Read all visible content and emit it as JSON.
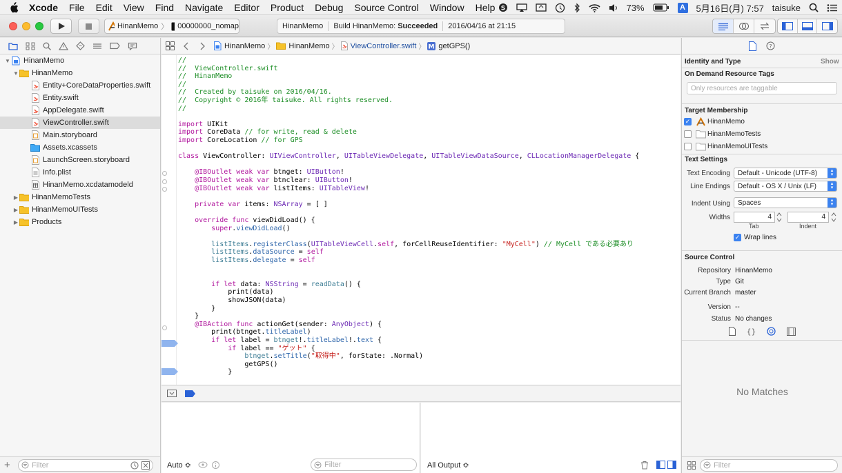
{
  "menubar": {
    "app_name": "Xcode",
    "items": [
      "File",
      "Edit",
      "View",
      "Find",
      "Navigate",
      "Editor",
      "Product",
      "Debug",
      "Source Control",
      "Window",
      "Help"
    ],
    "battery": "73%",
    "ime": "A",
    "clock": "5月16日(月)  7:57",
    "user": "taisuke"
  },
  "toolbar": {
    "scheme_target": "HinanMemo",
    "scheme_device": "00000000_nomap",
    "activity_project": "HinanMemo",
    "activity_action": "Build HinanMemo:",
    "activity_status": "Succeeded",
    "activity_time": "2016/04/16 at 21:15"
  },
  "navigator": {
    "items": [
      {
        "label": "HinanMemo",
        "icon": "project-icon",
        "disclosure": "▼"
      },
      {
        "label": "HinanMemo",
        "icon": "folder-icon",
        "disclosure": "▼"
      },
      {
        "label": "Entity+CoreDataProperties.swift",
        "icon": "swift-file-icon",
        "disclosure": ""
      },
      {
        "label": "Entity.swift",
        "icon": "swift-file-icon",
        "disclosure": ""
      },
      {
        "label": "AppDelegate.swift",
        "icon": "swift-file-icon",
        "disclosure": ""
      },
      {
        "label": "ViewController.swift",
        "icon": "swift-file-icon",
        "disclosure": "",
        "selected": true
      },
      {
        "label": "Main.storyboard",
        "icon": "storyboard-icon",
        "disclosure": ""
      },
      {
        "label": "Assets.xcassets",
        "icon": "assets-icon",
        "disclosure": ""
      },
      {
        "label": "LaunchScreen.storyboard",
        "icon": "storyboard-icon",
        "disclosure": ""
      },
      {
        "label": "Info.plist",
        "icon": "plist-icon",
        "disclosure": ""
      },
      {
        "label": "HinanMemo.xcdatamodeld",
        "icon": "datamodel-icon",
        "disclosure": ""
      },
      {
        "label": "HinanMemoTests",
        "icon": "folder-icon",
        "disclosure": "▶"
      },
      {
        "label": "HinanMemoUITests",
        "icon": "folder-icon",
        "disclosure": "▶"
      },
      {
        "label": "Products",
        "icon": "folder-icon",
        "disclosure": "▶"
      }
    ],
    "filter_placeholder": "Filter"
  },
  "jumpbar": {
    "crumbs": [
      "HinanMemo",
      "HinanMemo",
      "ViewController.swift",
      "getGPS()"
    ]
  },
  "code_lines": [
    [
      [
        "cmt",
        "//"
      ]
    ],
    [
      [
        "cmt",
        "//  ViewController.swift"
      ]
    ],
    [
      [
        "cmt",
        "//  HinanMemo"
      ]
    ],
    [
      [
        "cmt",
        "//"
      ]
    ],
    [
      [
        "cmt",
        "//  Created by taisuke on 2016/04/16."
      ]
    ],
    [
      [
        "cmt",
        "//  Copyright © 2016年 taisuke. All rights reserved."
      ]
    ],
    [
      [
        "cmt",
        "//"
      ]
    ],
    [],
    [
      [
        "kw",
        "import"
      ],
      [
        "pl",
        " UIKit"
      ]
    ],
    [
      [
        "kw",
        "import"
      ],
      [
        "pl",
        " CoreData "
      ],
      [
        "cmt",
        "// for write, read & delete"
      ]
    ],
    [
      [
        "kw",
        "import"
      ],
      [
        "pl",
        " CoreLocation "
      ],
      [
        "cmt",
        "// for GPS"
      ]
    ],
    [],
    [
      [
        "kw",
        "class"
      ],
      [
        "pl",
        " ViewController: "
      ],
      [
        "ty",
        "UIViewController"
      ],
      [
        "pl",
        ", "
      ],
      [
        "ty",
        "UITableViewDelegate"
      ],
      [
        "pl",
        ", "
      ],
      [
        "ty",
        "UITableViewDataSource"
      ],
      [
        "pl",
        ", "
      ],
      [
        "ty",
        "CLLocationManagerDelegate"
      ],
      [
        "pl",
        " {"
      ]
    ],
    [],
    [
      [
        "pl",
        "    "
      ],
      [
        "kw",
        "@IBOutlet weak var"
      ],
      [
        "pl",
        " btnget: "
      ],
      [
        "ty",
        "UIButton"
      ],
      [
        "pl",
        "!"
      ]
    ],
    [
      [
        "pl",
        "    "
      ],
      [
        "kw",
        "@IBOutlet weak var"
      ],
      [
        "pl",
        " btnclear: "
      ],
      [
        "ty",
        "UIButton"
      ],
      [
        "pl",
        "!"
      ]
    ],
    [
      [
        "pl",
        "    "
      ],
      [
        "kw",
        "@IBOutlet weak var"
      ],
      [
        "pl",
        " listItems: "
      ],
      [
        "ty",
        "UITableView"
      ],
      [
        "pl",
        "!"
      ]
    ],
    [],
    [
      [
        "pl",
        "    "
      ],
      [
        "kw",
        "private var"
      ],
      [
        "pl",
        " items: "
      ],
      [
        "ty",
        "NSArray"
      ],
      [
        "pl",
        " = [ ]"
      ]
    ],
    [],
    [
      [
        "pl",
        "    "
      ],
      [
        "kw",
        "override func"
      ],
      [
        "pl",
        " viewDidLoad() {"
      ]
    ],
    [
      [
        "pl",
        "        "
      ],
      [
        "kw",
        "super"
      ],
      [
        "pl",
        "."
      ],
      [
        "fn",
        "viewDidLoad"
      ],
      [
        "pl",
        "()"
      ]
    ],
    [],
    [
      [
        "pl",
        "        "
      ],
      [
        "cls",
        "listItems"
      ],
      [
        "pl",
        "."
      ],
      [
        "fn",
        "registerClass"
      ],
      [
        "pl",
        "("
      ],
      [
        "ty",
        "UITableViewCell"
      ],
      [
        "pl",
        "."
      ],
      [
        "kw",
        "self"
      ],
      [
        "pl",
        ", forCellReuseIdentifier: "
      ],
      [
        "str",
        "\"MyCell\""
      ],
      [
        "pl",
        ") "
      ],
      [
        "cmt",
        "// MyCell である必要あり"
      ]
    ],
    [
      [
        "pl",
        "        "
      ],
      [
        "cls",
        "listItems"
      ],
      [
        "pl",
        "."
      ],
      [
        "fn",
        "dataSource"
      ],
      [
        "pl",
        " = "
      ],
      [
        "kw",
        "self"
      ]
    ],
    [
      [
        "pl",
        "        "
      ],
      [
        "cls",
        "listItems"
      ],
      [
        "pl",
        "."
      ],
      [
        "fn",
        "delegate"
      ],
      [
        "pl",
        " = "
      ],
      [
        "kw",
        "self"
      ]
    ],
    [],
    [],
    [
      [
        "pl",
        "        "
      ],
      [
        "kw",
        "if let"
      ],
      [
        "pl",
        " data: "
      ],
      [
        "ty",
        "NSString"
      ],
      [
        "pl",
        " = "
      ],
      [
        "cls",
        "readData"
      ],
      [
        "pl",
        "() {"
      ]
    ],
    [
      [
        "pl",
        "            print(data)"
      ]
    ],
    [
      [
        "pl",
        "            showJSON(data)"
      ]
    ],
    [
      [
        "pl",
        "        }"
      ]
    ],
    [
      [
        "pl",
        "    }"
      ]
    ],
    [
      [
        "pl",
        "    "
      ],
      [
        "kw",
        "@IBAction func"
      ],
      [
        "pl",
        " actionGet(sender: "
      ],
      [
        "ty",
        "AnyObject"
      ],
      [
        "pl",
        ") {"
      ]
    ],
    [
      [
        "pl",
        "        print(btnget."
      ],
      [
        "fn",
        "titleLabel"
      ],
      [
        "pl",
        ")"
      ]
    ],
    [
      [
        "pl",
        "        "
      ],
      [
        "kw",
        "if let"
      ],
      [
        "pl",
        " label = "
      ],
      [
        "cls",
        "btnget"
      ],
      [
        "pl",
        "!."
      ],
      [
        "fn",
        "titleLabel"
      ],
      [
        "pl",
        "!."
      ],
      [
        "fn",
        "text"
      ],
      [
        "pl",
        " {"
      ]
    ],
    [
      [
        "pl",
        "            "
      ],
      [
        "kw",
        "if"
      ],
      [
        "pl",
        " label == "
      ],
      [
        "str",
        "\"ゲット\""
      ],
      [
        "pl",
        " {"
      ]
    ],
    [
      [
        "pl",
        "                "
      ],
      [
        "cls",
        "btnget"
      ],
      [
        "pl",
        "."
      ],
      [
        "fn",
        "setTitle"
      ],
      [
        "pl",
        "("
      ],
      [
        "str",
        "\"取得中\""
      ],
      [
        "pl",
        ", forState: .Normal)"
      ]
    ],
    [
      [
        "pl",
        "                getGPS()"
      ]
    ],
    [
      [
        "pl",
        "            }"
      ]
    ]
  ],
  "debug": {
    "auto_label": "Auto ≎",
    "filter_placeholder": "Filter",
    "output_label": "All Output ≎"
  },
  "inspector": {
    "identity_header": "Identity and Type",
    "identity_show": "Show",
    "odr_header": "On Demand Resource Tags",
    "odr_placeholder": "Only resources are taggable",
    "membership_header": "Target Membership",
    "targets": [
      {
        "label": "HinanMemo",
        "checked": true,
        "icon": "app-target-icon"
      },
      {
        "label": "HinanMemoTests",
        "checked": false,
        "icon": "test-target-icon"
      },
      {
        "label": "HinanMemoUITests",
        "checked": false,
        "icon": "test-target-icon"
      }
    ],
    "text_settings_header": "Text Settings",
    "encoding_label": "Text Encoding",
    "encoding_value": "Default - Unicode (UTF-8)",
    "line_endings_label": "Line Endings",
    "line_endings_value": "Default - OS X / Unix (LF)",
    "indent_label": "Indent Using",
    "indent_value": "Spaces",
    "widths_label": "Widths",
    "tab_value": "4",
    "tab_label": "Tab",
    "indent_width_value": "4",
    "indent_width_label": "Indent",
    "wrap_label": "Wrap lines",
    "source_control_header": "Source Control",
    "repo_label": "Repository",
    "repo_value": "HinanMemo",
    "type_label": "Type",
    "type_value": "Git",
    "branch_label": "Current Branch",
    "branch_value": "master",
    "version_label": "Version",
    "version_value": "--",
    "status_label": "Status",
    "status_value": "No changes",
    "no_matches": "No Matches",
    "filter_placeholder": "Filter"
  },
  "colors": {
    "comment": "#1d8e26",
    "keyword": "#b0169d",
    "type": "#6b28b4",
    "string": "#c41a16",
    "accent": "#3b82f0"
  }
}
